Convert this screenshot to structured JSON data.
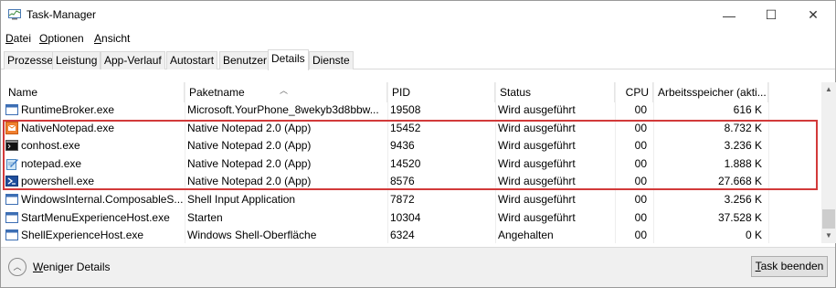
{
  "window": {
    "title": "Task-Manager",
    "minimize_glyph": "—",
    "maximize_glyph": "☐",
    "close_glyph": "✕"
  },
  "menu": {
    "file": {
      "u": "D",
      "rest": "atei"
    },
    "options": {
      "u": "O",
      "rest": "ptionen"
    },
    "view": {
      "u": "A",
      "rest": "nsicht"
    }
  },
  "tabs": [
    "Prozesse",
    "Leistung",
    "App-Verlauf",
    "Autostart",
    "Benutzer",
    "Details",
    "Dienste"
  ],
  "active_tab": "Details",
  "columns": {
    "name": "Name",
    "package": "Paketname",
    "pid": "PID",
    "status": "Status",
    "cpu": "CPU",
    "memory": "Arbeitsspeicher (akti..."
  },
  "rows": [
    {
      "name": "RuntimeBroker.exe",
      "package": "Microsoft.YourPhone_8wekyb3d8bbw...",
      "pid": "19508",
      "status": "Wird ausgeführt",
      "cpu": "00",
      "memory": "616 K",
      "icon": "window-app-icon"
    },
    {
      "name": "NativeNotepad.exe",
      "package": "Native Notepad 2.0 (App)",
      "pid": "15452",
      "status": "Wird ausgeführt",
      "cpu": "00",
      "memory": "8.732 K",
      "icon": "native-notepad-icon"
    },
    {
      "name": "conhost.exe",
      "package": "Native Notepad 2.0 (App)",
      "pid": "9436",
      "status": "Wird ausgeführt",
      "cpu": "00",
      "memory": "3.236 K",
      "icon": "console-icon"
    },
    {
      "name": "notepad.exe",
      "package": "Native Notepad 2.0 (App)",
      "pid": "14520",
      "status": "Wird ausgeführt",
      "cpu": "00",
      "memory": "1.888 K",
      "icon": "notepad-icon"
    },
    {
      "name": "powershell.exe",
      "package": "Native Notepad 2.0 (App)",
      "pid": "8576",
      "status": "Wird ausgeführt",
      "cpu": "00",
      "memory": "27.668 K",
      "icon": "powershell-icon"
    },
    {
      "name": "WindowsInternal.ComposableS...",
      "package": "Shell Input Application",
      "pid": "7872",
      "status": "Wird ausgeführt",
      "cpu": "00",
      "memory": "3.256 K",
      "icon": "window-app-icon"
    },
    {
      "name": "StartMenuExperienceHost.exe",
      "package": "Starten",
      "pid": "10304",
      "status": "Wird ausgeführt",
      "cpu": "00",
      "memory": "37.528 K",
      "icon": "window-app-icon"
    },
    {
      "name": "ShellExperienceHost.exe",
      "package": "Windows Shell-Oberfläche",
      "pid": "6324",
      "status": "Angehalten",
      "cpu": "00",
      "memory": "0 K",
      "icon": "window-app-icon"
    }
  ],
  "footer": {
    "fewer_details": {
      "u": "W",
      "rest": "eniger Details"
    },
    "end_task": {
      "u": "T",
      "rest": "ask beenden"
    }
  },
  "colors": {
    "highlight": "#d23a3a",
    "powershell_blue": "#1f4e9c",
    "notepad_orange": "#f08030"
  }
}
